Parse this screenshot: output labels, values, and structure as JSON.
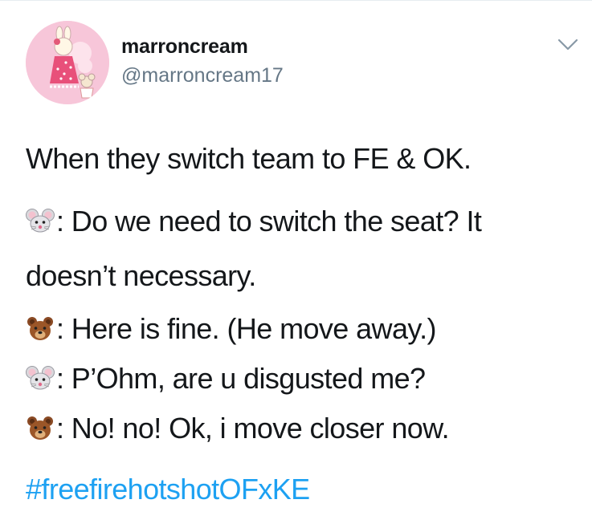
{
  "tweet": {
    "author": {
      "display_name": "marroncream",
      "handle": "@marroncream17"
    },
    "lines": [
      {
        "text": "When they switch team to FE & OK."
      },
      {
        "speaker_icon": "mouse-face-icon",
        "text": ": Do we need to switch the seat? It"
      },
      {
        "text": "doesn’t necessary."
      },
      {
        "speaker_icon": "bear-face-icon",
        "text": ": Here is fine. (He move away.)"
      },
      {
        "speaker_icon": "mouse-face-icon",
        "text": ": P’Ohm, are u disgusted me?"
      },
      {
        "speaker_icon": "bear-face-icon",
        "text": ": No! no! Ok, i move closer now."
      }
    ],
    "hashtag": "#freefirehotshotOFxKE",
    "menu_icon": "chevron-down-icon"
  },
  "colors": {
    "text": "#14171a",
    "secondary": "#657786",
    "link": "#1da1f2",
    "avatar_bg": "#f7c6d9"
  }
}
